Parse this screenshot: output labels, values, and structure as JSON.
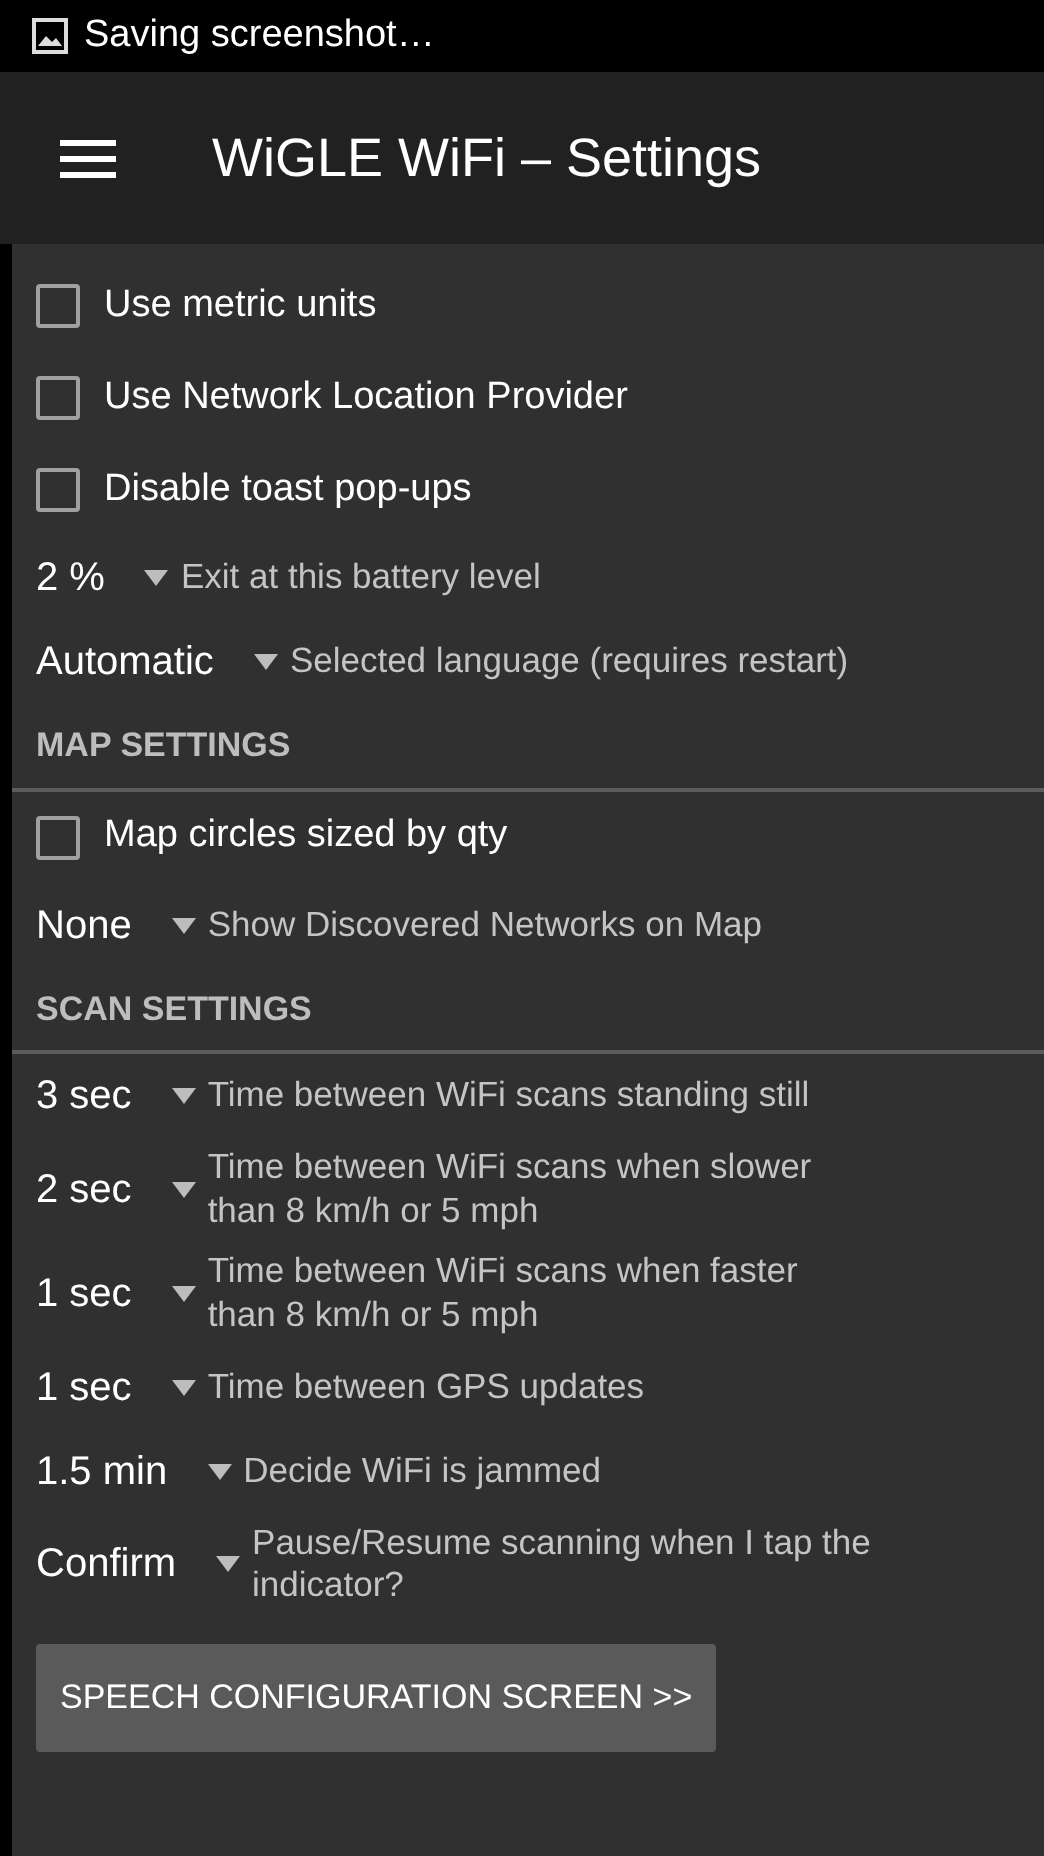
{
  "status_bar": {
    "text": "Saving screenshot…"
  },
  "app_bar": {
    "title": "WiGLE WiFi – Settings"
  },
  "settings": [
    {
      "kind": "checkbox",
      "label": "Use metric units",
      "checked": false
    },
    {
      "kind": "checkbox",
      "label": "Use Network Location Provider",
      "checked": false
    },
    {
      "kind": "checkbox",
      "label": "Disable toast pop-ups",
      "checked": false
    },
    {
      "kind": "spinner",
      "value": "2 %",
      "label": "Exit at this battery level"
    },
    {
      "kind": "spinner",
      "value": "Automatic",
      "label": "Selected language (requires restart)"
    },
    {
      "kind": "header",
      "label": "MAP SETTINGS"
    },
    {
      "kind": "checkbox",
      "label": "Map circles sized by qty",
      "checked": false
    },
    {
      "kind": "spinner",
      "value": "None",
      "label": "Show Discovered Networks on Map"
    },
    {
      "kind": "header",
      "label": "SCAN SETTINGS"
    },
    {
      "kind": "spinner",
      "value": "3 sec",
      "label": "Time between WiFi scans standing still"
    },
    {
      "kind": "spinner",
      "value": "2 sec",
      "label": "Time between WiFi scans when slower than 8 km/h or 5 mph"
    },
    {
      "kind": "spinner",
      "value": "1 sec",
      "label": "Time between WiFi scans when faster than 8 km/h or 5 mph"
    },
    {
      "kind": "spinner",
      "value": "1 sec",
      "label": "Time between GPS updates"
    },
    {
      "kind": "spinner",
      "value": "1.5 min",
      "label": "Decide WiFi is jammed"
    },
    {
      "kind": "spinner",
      "value": "Confirm",
      "label": "Pause/Resume scanning when I tap the indicator?"
    }
  ],
  "button": {
    "label": "SPEECH CONFIGURATION SCREEN >>"
  }
}
